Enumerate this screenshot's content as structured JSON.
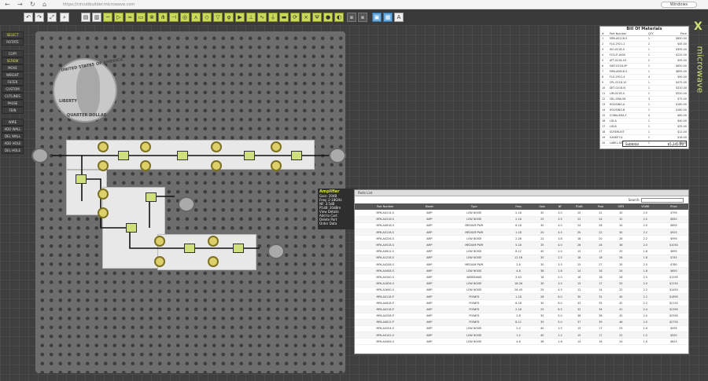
{
  "browser": {
    "url": "https://circuitbuilder.microwave.com",
    "profile": "Windows"
  },
  "sidebar": {
    "items": [
      "SELECT",
      "ROTATE",
      "COPY",
      "SCREW",
      "MOVE",
      "WEIGHT",
      "FILTER",
      "CUSTOM",
      "CUTLINES",
      "PAUSE",
      "FEIN",
      "WIRE",
      "ADD WALL",
      "DEL WALL",
      "ADD HOLE",
      "DEL HOLE"
    ]
  },
  "coin": {
    "top": "UNITED STATES OF AMERICA",
    "left": "LIBERTY",
    "bottom": "QUARTER DOLLAR"
  },
  "tooltip": {
    "title": "Amplifier",
    "lines": [
      "Gain: 20dB",
      "Freq: 2-18GHz",
      "NF: 3.5dB",
      "P1dB: 20dBm"
    ],
    "options": [
      "View Details",
      "Add to Cart",
      "Delete Part",
      "Order Data"
    ]
  },
  "table": {
    "title": "Parts List",
    "search_label": "Search:",
    "headers": [
      "Part Number",
      "Model",
      "Type",
      "Freq",
      "Gain",
      "NF",
      "P1dB",
      "Psat",
      "OIP3",
      "VSWR",
      "Price"
    ],
    "rows": [
      [
        "MPA-A0214-S",
        "AMP",
        "LOW NOISE",
        "2-18",
        "30",
        "3.0",
        "20",
        "22",
        "30",
        "2.0",
        "$795"
      ],
      [
        "MPA-A0218-S",
        "AMP",
        "LOW NOISE",
        "2-18",
        "25",
        "3.5",
        "22",
        "24",
        "32",
        "2.0",
        "$850"
      ],
      [
        "MPA-A0618-S",
        "AMP",
        "MEDIUM PWR",
        "6-18",
        "30",
        "4.0",
        "24",
        "26",
        "34",
        "2.0",
        "$895"
      ],
      [
        "MPA-A0118-S",
        "AMP",
        "MEDIUM PWR",
        "1-18",
        "20",
        "4.5",
        "20",
        "22",
        "30",
        "2.2",
        "$925"
      ],
      [
        "MPA-A0226-S",
        "AMP",
        "LOW NOISE",
        "2-26",
        "22",
        "3.8",
        "18",
        "20",
        "28",
        "2.2",
        "$995"
      ],
      [
        "MPA-A0518-S",
        "AMP",
        "MEDIUM PWR",
        "5-18",
        "35",
        "4.0",
        "26",
        "28",
        "36",
        "2.0",
        "$1050"
      ],
      [
        "MPA-A0812-S",
        "AMP",
        "LOW NOISE",
        "8-12",
        "40",
        "2.0",
        "15",
        "17",
        "25",
        "1.8",
        "$695"
      ],
      [
        "MPA-A1218-S",
        "AMP",
        "LOW NOISE",
        "12-18",
        "35",
        "2.5",
        "16",
        "18",
        "26",
        "1.8",
        "$745"
      ],
      [
        "MPA-A0208-S",
        "AMP",
        "MEDIUM PWR",
        "2-8",
        "30",
        "3.5",
        "25",
        "27",
        "35",
        "2.0",
        "$780"
      ],
      [
        "MPA-A0408-S",
        "AMP",
        "LOW NOISE",
        "4-8",
        "38",
        "1.8",
        "14",
        "16",
        "24",
        "1.8",
        "$650"
      ],
      [
        "MPA-A0240-S",
        "AMP",
        "WIDEBAND",
        "2-40",
        "18",
        "5.0",
        "16",
        "18",
        "26",
        "2.5",
        "$1295"
      ],
      [
        "MPA-A1826-S",
        "AMP",
        "LOW NOISE",
        "18-26",
        "30",
        "3.5",
        "15",
        "17",
        "25",
        "2.0",
        "$1150"
      ],
      [
        "MPA-A2640-S",
        "AMP",
        "LOW NOISE",
        "26-40",
        "25",
        "4.5",
        "12",
        "14",
        "22",
        "2.2",
        "$1450"
      ],
      [
        "MPA-A0118-P",
        "AMP",
        "POWER",
        "1-18",
        "28",
        "6.0",
        "30",
        "32",
        "40",
        "2.2",
        "$1895"
      ],
      [
        "MPA-A0618-P",
        "AMP",
        "POWER",
        "6-18",
        "30",
        "6.0",
        "33",
        "35",
        "42",
        "2.2",
        "$2150"
      ],
      [
        "MPA-A0218-P",
        "AMP",
        "POWER",
        "2-18",
        "25",
        "6.5",
        "32",
        "34",
        "41",
        "2.4",
        "$2395"
      ],
      [
        "MPA-A0208-P",
        "AMP",
        "POWER",
        "2-8",
        "35",
        "5.0",
        "36",
        "38",
        "45",
        "2.0",
        "$2595"
      ],
      [
        "MPA-A0812-P",
        "AMP",
        "POWER",
        "8-12",
        "35",
        "5.0",
        "37",
        "39",
        "46",
        "2.0",
        "$2750"
      ],
      [
        "MPA-A0204-S",
        "AMP",
        "LOW NOISE",
        "2-4",
        "40",
        "1.5",
        "15",
        "17",
        "25",
        "1.6",
        "$595"
      ],
      [
        "MPA-A0102-S",
        "AMP",
        "LOW NOISE",
        "1-2",
        "40",
        "1.2",
        "15",
        "17",
        "25",
        "1.5",
        "$550"
      ],
      [
        "MPA-A0406-S",
        "AMP",
        "LOW NOISE",
        "4-6",
        "38",
        "1.6",
        "14",
        "16",
        "24",
        "1.6",
        "$625"
      ]
    ]
  },
  "bom": {
    "title": "Bill Of Materials",
    "headers": [
      "#",
      "Part Number",
      "QTY",
      "Price"
    ],
    "rows": [
      [
        "1",
        "MPA-A0218-S",
        "1",
        "$850.00"
      ],
      [
        "2",
        "FLG-2921-2",
        "2",
        "$45.00"
      ],
      [
        "3",
        "ISO-0218-S",
        "1",
        "$395.00"
      ],
      [
        "4",
        "FLT-LP-1800",
        "1",
        "$225.00"
      ],
      [
        "5",
        "ATT-0218-03",
        "2",
        "$95.00"
      ],
      [
        "6",
        "SWT-0218-SP",
        "1",
        "$650.00"
      ],
      [
        "7",
        "MPA-A0618-S",
        "1",
        "$895.00"
      ],
      [
        "8",
        "FLG-2921-4",
        "4",
        "$90.00"
      ],
      [
        "9",
        "CPL-0218-10",
        "1",
        "$475.00"
      ],
      [
        "10",
        "DET-0218-N",
        "1",
        "$310.00"
      ],
      [
        "11",
        "LIM-0218-S",
        "1",
        "$520.00"
      ],
      [
        "12",
        "CBL-SMA-06",
        "3",
        "$75.00"
      ],
      [
        "13",
        "HOUSING-A",
        "1",
        "$180.00"
      ],
      [
        "14",
        "HOUSING-B",
        "1",
        "$160.00"
      ],
      [
        "15",
        "CONN-SMA-F",
        "4",
        "$60.00"
      ],
      [
        "16",
        "LID-A",
        "1",
        "$40.00"
      ],
      [
        "17",
        "LID-B",
        "1",
        "$35.00"
      ],
      [
        "18",
        "SCREW-KIT",
        "1",
        "$12.00"
      ],
      [
        "19",
        "GASKET-A",
        "1",
        "$18.00"
      ],
      [
        "20",
        "LABEL-SET",
        "1",
        "$5.00"
      ]
    ],
    "footer_label": "Subtotal",
    "footer_value": "$5,245.00"
  },
  "brand": {
    "mark": "X",
    "name": "microwave"
  },
  "colors": {
    "accent": "#cfe07a",
    "canvas": "#3f3f3f",
    "panel": "#6d6d6d"
  }
}
